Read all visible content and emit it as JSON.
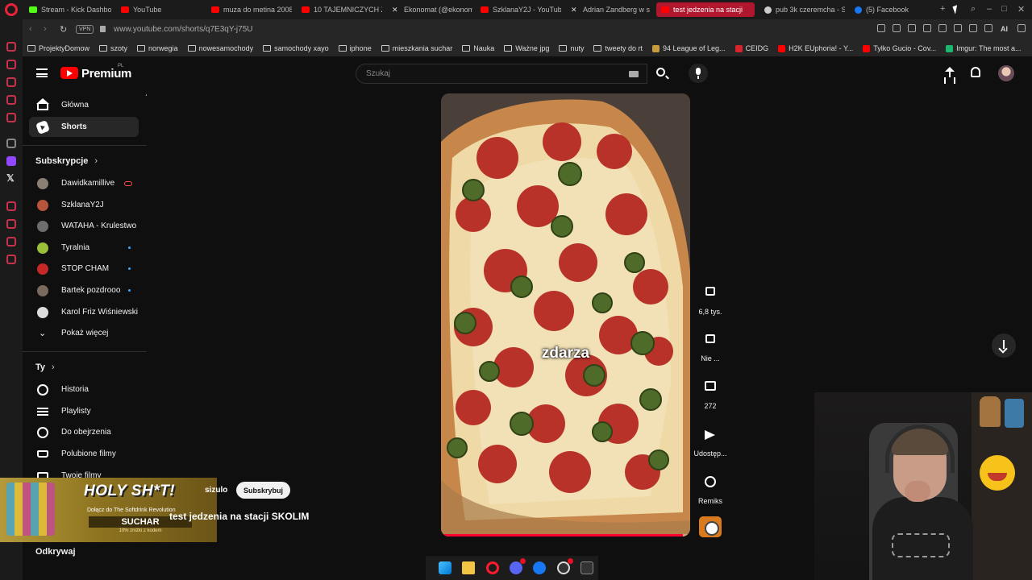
{
  "browser": {
    "tabs": [
      {
        "label": "Stream - Kick Dashbo",
        "icon": "kick-icon",
        "active": false
      },
      {
        "label": "YouTube",
        "icon": "youtube-icon",
        "active": false
      },
      {
        "label": "muza do metina 2008",
        "icon": "youtube-icon",
        "active": false
      },
      {
        "label": "10 TAJEMNICZYCH Z",
        "icon": "youtube-icon",
        "active": false
      },
      {
        "label": "Ekonomat (@ekonom",
        "icon": "x-icon",
        "active": false
      },
      {
        "label": "SzklanaY2J - YouTub",
        "icon": "youtube-icon",
        "active": false
      },
      {
        "label": "Adrian Zandberg w s",
        "icon": "x-icon",
        "active": false
      },
      {
        "label": "test jedzenia na stacji",
        "icon": "youtube-icon",
        "active": true
      },
      {
        "label": "pub 3k czeremcha - S",
        "icon": "google-icon",
        "active": false
      },
      {
        "label": "(5) Facebook",
        "icon": "facebook-icon",
        "active": false
      }
    ],
    "vpn_label": "VPN",
    "url": "www.youtube.com/shorts/q7E3qY-j75U",
    "ai_label": "AI",
    "bookmarks": [
      {
        "label": "ProjektyDomow",
        "type": "folder"
      },
      {
        "label": "szoty",
        "type": "folder"
      },
      {
        "label": "norwegia",
        "type": "folder"
      },
      {
        "label": "nowesamochody",
        "type": "folder"
      },
      {
        "label": "samochody xayo",
        "type": "folder"
      },
      {
        "label": "iphone",
        "type": "folder"
      },
      {
        "label": "mieszkania suchar",
        "type": "folder"
      },
      {
        "label": "Nauka",
        "type": "folder"
      },
      {
        "label": "Ważne jpg",
        "type": "folder"
      },
      {
        "label": "nuty",
        "type": "folder"
      },
      {
        "label": "tweety do rt",
        "type": "folder"
      },
      {
        "label": "94 League of Leg...",
        "type": "site"
      },
      {
        "label": "CEIDG",
        "type": "site"
      },
      {
        "label": "H2K EUphoria! - Y...",
        "type": "site"
      },
      {
        "label": "Tylko Gucio - Cov...",
        "type": "site"
      },
      {
        "label": "Imgur: The most a...",
        "type": "site"
      }
    ]
  },
  "youtube": {
    "brand": "Premium",
    "country": "PL",
    "search_placeholder": "Szukaj",
    "guide": {
      "main": [
        {
          "label": "Główna",
          "icon": "home-icon",
          "active": false
        },
        {
          "label": "Shorts",
          "icon": "shorts-icon",
          "active": true
        }
      ],
      "subscriptions_heading": "Subskrypcje",
      "subscriptions": [
        {
          "label": "Dawidkamillive",
          "indicator": "live",
          "color": "#8a7f74"
        },
        {
          "label": "SzklanaY2J",
          "indicator": "",
          "color": "#b6543c"
        },
        {
          "label": "WATAHA - Krulestwo",
          "indicator": "",
          "color": "#6d6d6d"
        },
        {
          "label": "Tyralnia",
          "indicator": "new",
          "color": "#9bbf3a"
        },
        {
          "label": "STOP CHAM",
          "indicator": "new",
          "color": "#c62828"
        },
        {
          "label": "Bartek pozdrooo",
          "indicator": "new",
          "color": "#7a6a5e"
        },
        {
          "label": "Karol Friz Wiśniewski",
          "indicator": "",
          "color": "#dcdcdc"
        }
      ],
      "show_more": "Pokaż więcej",
      "you_heading": "Ty",
      "you": [
        {
          "label": "Historia",
          "icon": "history-icon"
        },
        {
          "label": "Playlisty",
          "icon": "playlists-icon"
        },
        {
          "label": "Do obejrzenia",
          "icon": "watch-later-icon"
        },
        {
          "label": "Polubione filmy",
          "icon": "liked-icon"
        },
        {
          "label": "Twoje filmy",
          "icon": "your-videos-icon"
        }
      ],
      "explore_heading": "Odkrywaj"
    },
    "short": {
      "caption": "zdarza",
      "progress_percent": 97,
      "channel_name": "sizulo",
      "subscribe_label": "Subskrybuj",
      "title": "test jedzenia na stacji SKOLIM",
      "actions": {
        "likes": "6,8 tys.",
        "dislike": "Nie ...",
        "comments": "272",
        "share": "Udostęp...",
        "remix": "Remiks"
      }
    }
  },
  "promo": {
    "headline": "HOLY SH*T!",
    "subline": "Dołącz do The Softdrink Revolution",
    "brand": "SUCHAR",
    "discount": "10% zniżki z kodem"
  }
}
